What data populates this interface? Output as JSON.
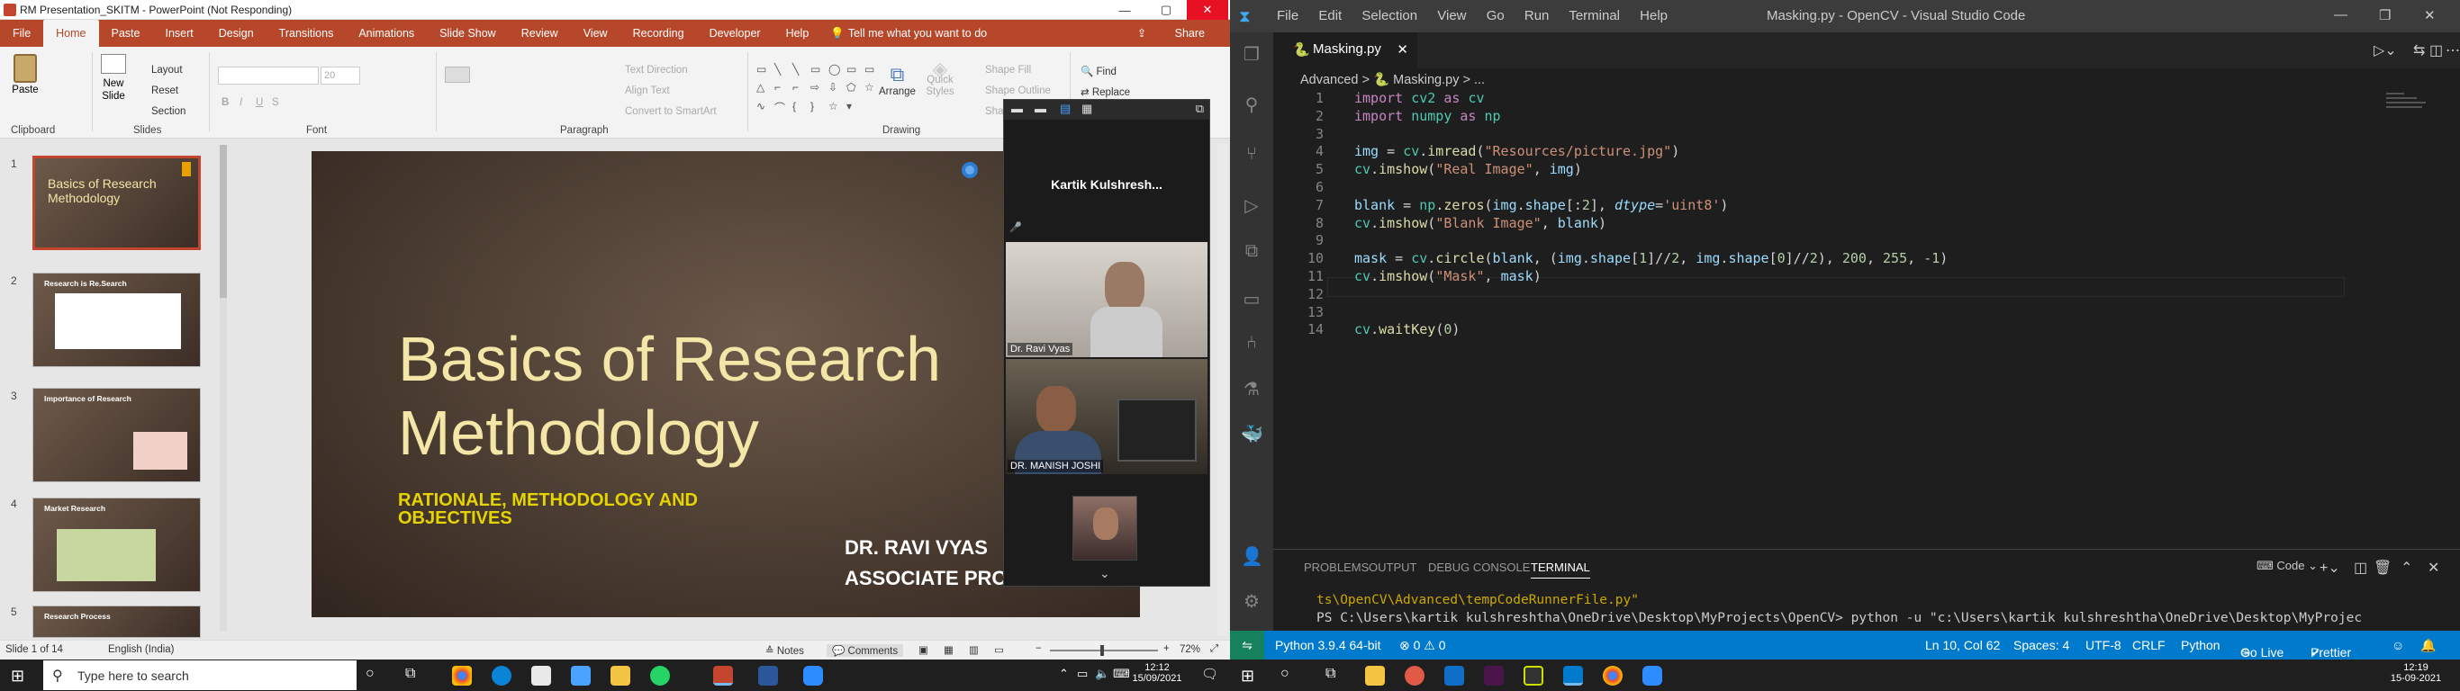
{
  "powerpoint": {
    "title": "RM Presentation_SKITM - PowerPoint (Not Responding)",
    "tabs": [
      "File",
      "Home",
      "Paste",
      "Insert",
      "Design",
      "Transitions",
      "Animations",
      "Slide Show",
      "Review",
      "View",
      "Recording",
      "Developer",
      "Help",
      "Tell me what you want to do"
    ],
    "share": "Share",
    "ribbon": {
      "paste": "Paste",
      "clipboard": "Clipboard",
      "new_slide": "New Slide",
      "layout": "Layout",
      "reset": "Reset",
      "section": "Section",
      "slides": "Slides",
      "font": "Font",
      "paragraph": "Paragraph",
      "drawing": "Drawing",
      "text_direction": "Text Direction",
      "align_text": "Align Text",
      "convert_smartart": "Convert to SmartArt",
      "arrange": "Arrange",
      "quick_styles": "Quick Styles",
      "shape_fill": "Shape Fill",
      "shape_outline": "Shape Outline",
      "shape_effects": "Shape",
      "find": "Find",
      "replace": "Replace",
      "font_size": "20"
    },
    "thumbnails": [
      {
        "num": "1",
        "title": "Basics of Research Methodology"
      },
      {
        "num": "2",
        "title": "Research is Re.Search"
      },
      {
        "num": "3",
        "title": "Importance of Research"
      },
      {
        "num": "4",
        "title": "Market Research"
      },
      {
        "num": "5",
        "title": "Research Process"
      }
    ],
    "slide": {
      "title_line1": "Basics of Research",
      "title_line2": "Methodology",
      "subtitle_line1": "RATIONALE, METHODOLOGY AND",
      "subtitle_line2": "OBJECTIVES",
      "author": "DR. RAVI VYAS",
      "role": "ASSOCIATE PRO"
    },
    "status": {
      "slide": "Slide 1 of 14",
      "language": "English (India)",
      "notes": "Notes",
      "comments": "Comments",
      "zoom": "72%"
    }
  },
  "zoom_panel": {
    "host": "Kartik  Kulshresh...",
    "participants": [
      {
        "name": "Dr. Ravi Vyas"
      },
      {
        "name": "DR. MANISH JOSHI"
      }
    ]
  },
  "taskbar_left": {
    "search_placeholder": "Type here to search",
    "time": "12:12",
    "date": "15/09/2021"
  },
  "vscode": {
    "menu": [
      "File",
      "Edit",
      "Selection",
      "View",
      "Go",
      "Run",
      "Terminal",
      "Help"
    ],
    "title": "Masking.py - OpenCV - Visual Studio Code",
    "tab": "Masking.py",
    "breadcrumb": [
      "Advanced",
      ">",
      "Masking.py",
      ">",
      "..."
    ],
    "code": [
      {
        "n": "1",
        "t": "import cv2 as cv"
      },
      {
        "n": "2",
        "t": "import numpy as np"
      },
      {
        "n": "3",
        "t": ""
      },
      {
        "n": "4",
        "t": "img = cv.imread(\"Resources/picture.jpg\")"
      },
      {
        "n": "5",
        "t": "cv.imshow(\"Real Image\", img)"
      },
      {
        "n": "6",
        "t": ""
      },
      {
        "n": "7",
        "t": "blank = np.zeros(img.shape[:2], dtype='uint8')"
      },
      {
        "n": "8",
        "t": "cv.imshow(\"Blank Image\", blank)"
      },
      {
        "n": "9",
        "t": ""
      },
      {
        "n": "10",
        "t": "mask = cv.circle(blank, (img.shape[1]//2, img.shape[0]//2), 200, 255, -1)"
      },
      {
        "n": "11",
        "t": "cv.imshow(\"Mask\", mask)"
      },
      {
        "n": "12",
        "t": ""
      },
      {
        "n": "13",
        "t": ""
      },
      {
        "n": "14",
        "t": "cv.waitKey(0)"
      }
    ],
    "panel_tabs": [
      "PROBLEMS",
      "OUTPUT",
      "DEBUG CONSOLE",
      "TERMINAL"
    ],
    "terminal_shell": "Code",
    "terminal": [
      "ts\\OpenCV\\Advanced\\tempCodeRunnerFile.py\"",
      "PS C:\\Users\\kartik kulshreshtha\\OneDrive\\Desktop\\MyProjects\\OpenCV> python -u \"c:\\Users\\kartik kulshreshtha\\OneDrive\\Desktop\\MyProjec"
    ],
    "status": {
      "python": "Python 3.9.4 64-bit",
      "problems": "⊗ 0  ⚠ 0",
      "position": "Ln 10, Col 62",
      "spaces": "Spaces: 4",
      "encoding": "UTF-8",
      "eol": "CRLF",
      "language": "Python",
      "golive": "Go Live",
      "prettier": "Prettier"
    }
  },
  "taskbar_right": {
    "time": "12:19",
    "date": "15-09-2021"
  },
  "colors": {
    "pp_accent": "#b7472a",
    "vs_status": "#007acc",
    "slide_title": "#f3e6a6",
    "slide_subtitle": "#e6d400"
  }
}
